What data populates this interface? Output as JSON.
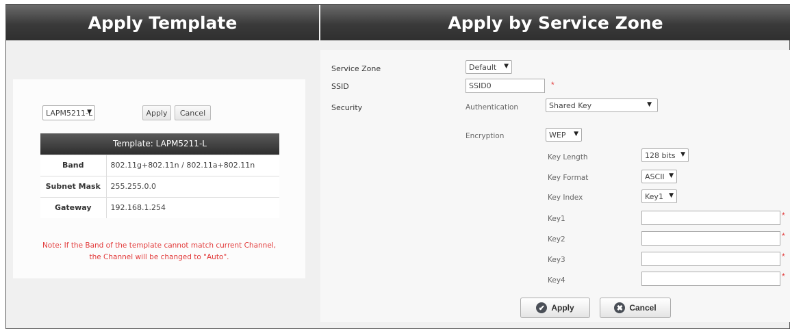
{
  "headers": {
    "left": "Apply Template",
    "right": "Apply by Service Zone"
  },
  "template_panel": {
    "template_select": "LAPM5211-L",
    "apply_label": "Apply",
    "cancel_label": "Cancel",
    "table_title": "Template: LAPM5211-L",
    "rows": [
      {
        "key": "Band",
        "value": "802.11g+802.11n / 802.11a+802.11n"
      },
      {
        "key": "Subnet Mask",
        "value": "255.255.0.0"
      },
      {
        "key": "Gateway",
        "value": "192.168.1.254"
      }
    ],
    "note_line1": "Note: If the Band of the template cannot match current Channel,",
    "note_line2": "the Channel will be changed to \"Auto\"."
  },
  "zone_panel": {
    "service_zone_label": "Service Zone",
    "service_zone_value": "Default",
    "ssid_label": "SSID",
    "ssid_value": "SSID0",
    "security_label": "Security",
    "authentication_label": "Authentication",
    "authentication_value": "Shared Key",
    "encryption_label": "Encryption",
    "encryption_value": "WEP",
    "key_length_label": "Key Length",
    "key_length_value": "128 bits",
    "key_format_label": "Key Format",
    "key_format_value": "ASCII",
    "key_index_label": "Key Index",
    "key_index_value": "Key1",
    "keys": [
      {
        "label": "Key1",
        "value": ""
      },
      {
        "label": "Key2",
        "value": ""
      },
      {
        "label": "Key3",
        "value": ""
      },
      {
        "label": "Key4",
        "value": ""
      }
    ],
    "required_mark": "*",
    "apply_label": "Apply",
    "cancel_label": "Cancel"
  },
  "icons": {
    "caret": "▼",
    "check": "✔",
    "close": "✖"
  }
}
